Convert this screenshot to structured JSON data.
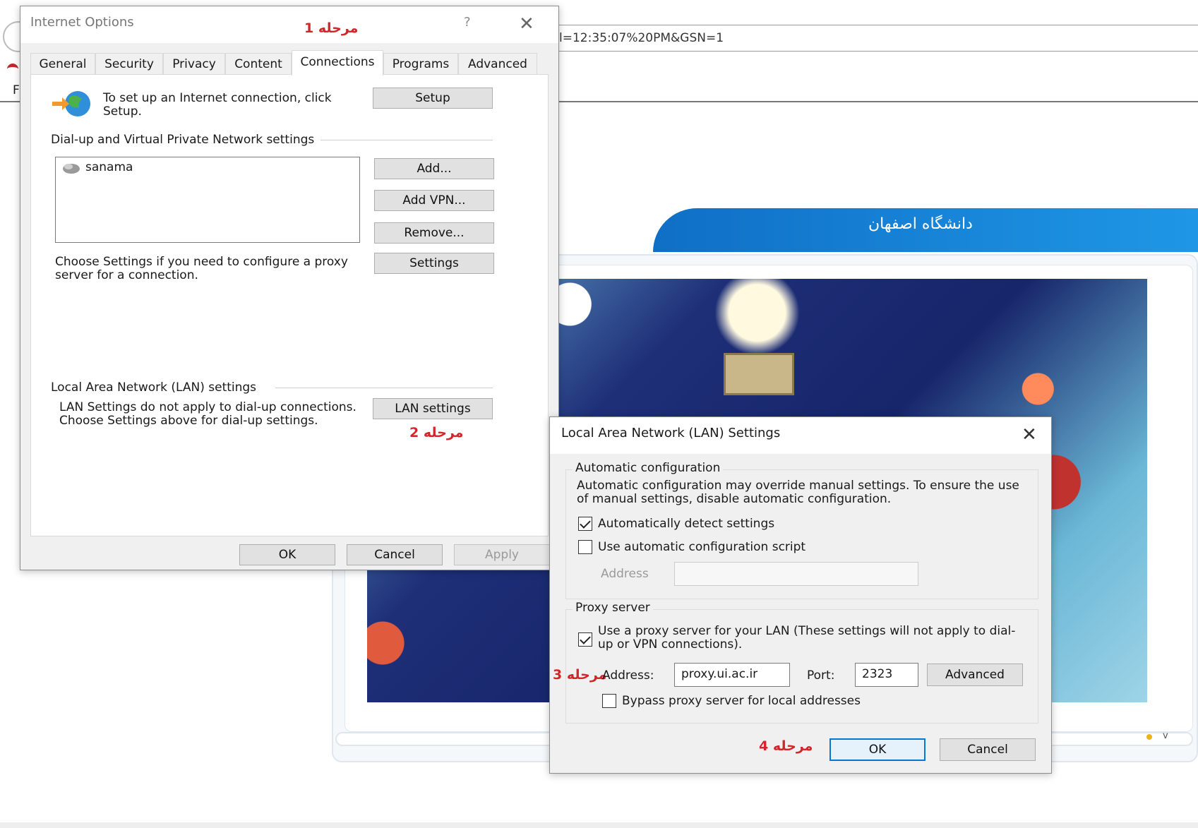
{
  "browser": {
    "address_text": "l=12:35:07%20PM&GSN=1",
    "f_letter": "F",
    "banner_text": "دانشگاه اصفهان",
    "pager_text": "v"
  },
  "internet_options": {
    "title": "Internet Options",
    "help_glyph": "?",
    "close_glyph": "✕",
    "tabs": [
      "General",
      "Security",
      "Privacy",
      "Content",
      "Connections",
      "Programs",
      "Advanced"
    ],
    "active_tab": "Connections",
    "setup_text": "To set up an Internet connection, click Setup.",
    "setup_button": "Setup",
    "dialup_group": "Dial-up and Virtual Private Network settings",
    "connections": [
      "sanama"
    ],
    "add_button": "Add...",
    "add_vpn_button": "Add VPN...",
    "remove_button": "Remove...",
    "settings_text": "Choose Settings if you need to configure a proxy server for a connection.",
    "settings_button": "Settings",
    "lan_group": "Local Area Network (LAN) settings",
    "lan_text": "LAN Settings do not apply to dial-up connections. Choose Settings above for dial-up settings.",
    "lan_button": "LAN settings",
    "ok_button": "OK",
    "cancel_button": "Cancel",
    "apply_button": "Apply"
  },
  "lan_dialog": {
    "title": "Local Area Network (LAN) Settings",
    "close_glyph": "✕",
    "auto_group": "Automatic configuration",
    "auto_text": "Automatic configuration may override manual settings.  To ensure the use of manual settings, disable automatic configuration.",
    "auto_detect_label": "Automatically detect settings",
    "auto_detect_checked": true,
    "auto_script_label": "Use automatic configuration script",
    "auto_script_checked": false,
    "script_address_label": "Address",
    "script_address_value": "",
    "proxy_group": "Proxy server",
    "use_proxy_label": "Use a proxy server for your LAN (These settings will not apply to dial-up or VPN connections).",
    "use_proxy_checked": true,
    "address_label": "Address:",
    "address_value": "proxy.ui.ac.ir",
    "port_label": "Port:",
    "port_value": "2323",
    "advanced_button": "Advanced",
    "bypass_label": "Bypass proxy server for local addresses",
    "bypass_checked": false,
    "ok_button": "OK",
    "cancel_button": "Cancel"
  },
  "annotations": {
    "step1": "مرحله 1",
    "step2": "مرحله 2",
    "step3": "مرحله 3",
    "step4": "مرحله 4"
  },
  "colors": {
    "annotation": "#d3262a",
    "banner": "#1584d9",
    "default_button_border": "#0078d7"
  }
}
